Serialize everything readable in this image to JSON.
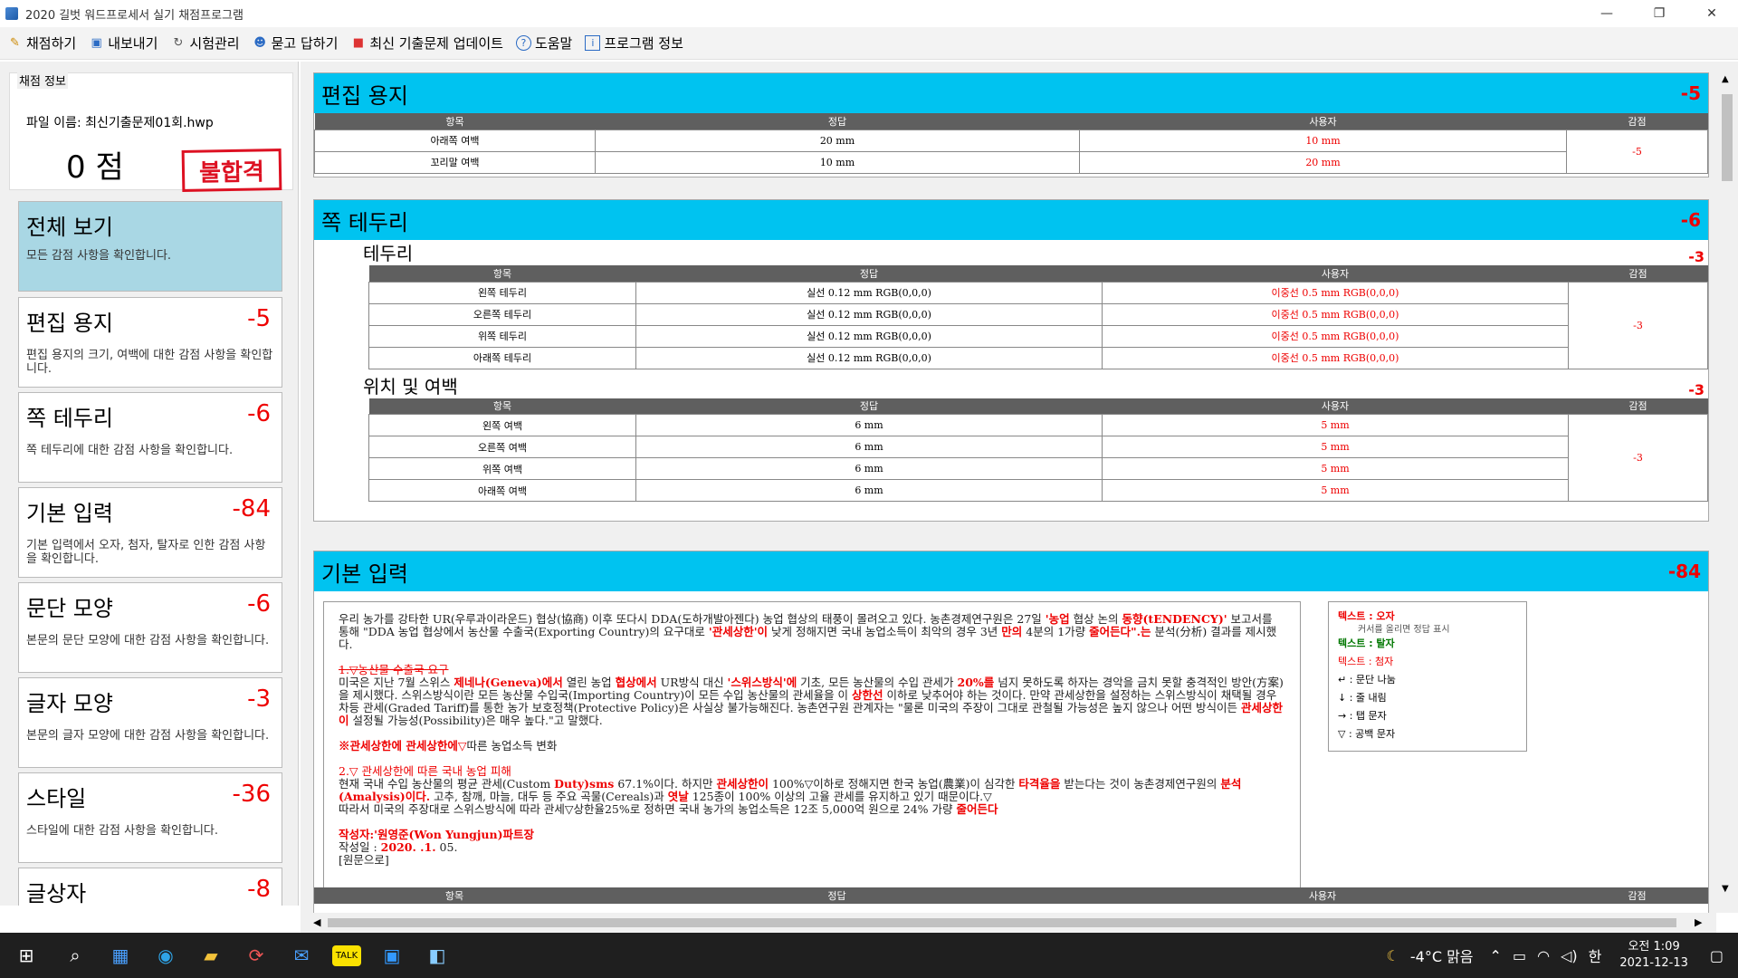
{
  "window": {
    "title": "2020 길벗 워드프로세서 실기 채점프로그램"
  },
  "menu": [
    {
      "label": "채점하기",
      "icon": "pencil-icon"
    },
    {
      "label": "내보내기",
      "icon": "save-icon"
    },
    {
      "label": "시험관리",
      "icon": "refresh-icon"
    },
    {
      "label": "묻고 답하기",
      "icon": "people-icon"
    },
    {
      "label": "최신 기출문제 업데이트",
      "icon": "gift-icon"
    },
    {
      "label": "도움말",
      "icon": "help-icon"
    },
    {
      "label": "프로그램 정보",
      "icon": "info-icon"
    }
  ],
  "info": {
    "label": "채점 정보",
    "file": "파일 이름: 최신기출문제01회.hwp",
    "score": "0 점",
    "result": "불합격"
  },
  "cards": [
    {
      "name": "전체 보기",
      "points": "",
      "desc": "모든 감점 사항을 확인합니다."
    },
    {
      "name": "편집 용지",
      "points": "-5",
      "desc": "편집 용지의 크기, 여백에 대한 감점 사항을 확인합니다."
    },
    {
      "name": "쪽 테두리",
      "points": "-6",
      "desc": "쪽 테두리에 대한 감점 사항을 확인합니다."
    },
    {
      "name": "기본 입력",
      "points": "-84",
      "desc": "기본 입력에서 오자, 첨자, 탈자로 인한 감점 사항을 확인합니다."
    },
    {
      "name": "문단 모양",
      "points": "-6",
      "desc": "본문의 문단 모양에 대한 감점 사항을 확인합니다."
    },
    {
      "name": "글자 모양",
      "points": "-3",
      "desc": "본문의 글자 모양에 대한 감점 사항을 확인합니다."
    },
    {
      "name": "스타일",
      "points": "-36",
      "desc": "스타일에 대한 감점 사항을 확인합니다."
    },
    {
      "name": "글상자",
      "points": "-8",
      "desc": ""
    }
  ],
  "headers": {
    "item": "항목",
    "answer": "정답",
    "user": "사용자",
    "deduct": "감점"
  },
  "sec1": {
    "title": "편집 용지",
    "points": "-5",
    "deduct": "-5",
    "rows": [
      [
        "아래쪽 여백",
        "20 mm",
        "10 mm"
      ],
      [
        "꼬리말 여백",
        "10 mm",
        "20 mm"
      ]
    ]
  },
  "sec2": {
    "title": "쪽 테두리",
    "points": "-6",
    "sub1": {
      "title": "테두리",
      "points": "-3",
      "deduct": "-3",
      "rows": [
        [
          "왼쪽 테두리",
          "실선 0.12 mm RGB(0,0,0)",
          "이중선 0.5 mm RGB(0,0,0)"
        ],
        [
          "오른쪽 테두리",
          "실선 0.12 mm RGB(0,0,0)",
          "이중선 0.5 mm RGB(0,0,0)"
        ],
        [
          "위쪽 테두리",
          "실선 0.12 mm RGB(0,0,0)",
          "이중선 0.5 mm RGB(0,0,0)"
        ],
        [
          "아래쪽 테두리",
          "실선 0.12 mm RGB(0,0,0)",
          "이중선 0.5 mm RGB(0,0,0)"
        ]
      ]
    },
    "sub2": {
      "title": "위치 및 여백",
      "points": "-3",
      "deduct": "-3",
      "rows": [
        [
          "왼쪽 여백",
          "6 mm",
          "5 mm"
        ],
        [
          "오른쪽 여백",
          "6 mm",
          "5 mm"
        ],
        [
          "위쪽 여백",
          "6 mm",
          "5 mm"
        ],
        [
          "아래쪽 여백",
          "6 mm",
          "5 mm"
        ]
      ]
    }
  },
  "sec3": {
    "title": "기본 입력",
    "points": "-84",
    "lines": [
      "우리 농가를 강타한 UR(우루과이라운드) 협상(協商) 이후 또다시 DDA(도하개발아젠다) 농업 협상의 태풍이 몰려오고 있다. 농촌경제연구원은 27일 ",
      "'농업",
      " 협상 논의 ",
      "동향(tENDENCY)'",
      " 보고서를 통해 \"DDA 농업 협상에서 농산물 수출국(Exporting Country)의 요구대로 ",
      "'관세상한'이",
      " 낮게 정해지면 국내 농업소득이 최악의 경우 3년 ",
      "만의",
      " 4분의 1가량 ",
      "줄어든다\".는",
      " 분석(分析) 결과를 제시했다.",
      "1.▽농산물 수출국 요구",
      "미국은 지난 7월 스위스 ",
      "제네나(Geneva)에서",
      " 열린 농업 ",
      "협상에서",
      " UR방식 대신 ",
      "'스위스방식'에",
      " 기초, 모든 농산물의 수입 관세가 ",
      "20%를",
      " 넘지 못하도록 하자는 경악을 금치 못할 충격적인 방안(方案)을 제시했다. 스위스방식이란 모든 농산물 수입국(Importing Country)이 모든 수입 농산물의 관세율을 이 ",
      "상한선",
      " 이하로 낮추어야 하는 것이다. 만약 관세상한을 설정하는 스위스방식이 채택될 경우 차등 관세(Graded Tariff)를 통한 농가 보호정책(Protective Policy)은 사실상 불가능해진다. 농촌연구원 관계자는 \"물론 미국의 주장이 그대로 관철될 가능성은 높지 않으나 어떤 방식이든 ",
      "관세상한이",
      " 설정될 가능성(Possibility)은 매우 높다.\"고 말했다.",
      "※관세상한에 관세상한에▽",
      "따른 농업소득 변화",
      "2.▽ 관세상한에 따른 국내 농업 피해",
      "현재 국내 수입 농산물의 평균 관세(Custom ",
      "Duty)sms",
      " 67.1%이다. 하지만 ",
      "관세상한이",
      " 100%▽이하로 정해지면 한국 농업(農業)이 심각한 ",
      "타격율을",
      " 받는다는 것이 농촌경제연구원의 ",
      "분석(Amalysis)이다.",
      " 고추, 참깨, 마늘, 대두 등 주요 곡물(Cereals)과 ",
      "엿날",
      " 125종이 100% 이상의 고율 관세를 유지하고 있기 때문이다.▽",
      "따라서 미국의 주장대로 스위스방식에 따라 관세▽상한율25%로 정하면 국내 농가의 농업소득은 12조 5,000억 원으로 24% 가량 ",
      "줄어든다",
      "작성자:'원영준(Won Yungjun)파트장",
      "작성일 : ",
      "2020. .1.",
      " 05.",
      "[원문으로]"
    ]
  },
  "legend": [
    "텍스트 : 오자",
    "커서를 올리면 정답 표시",
    "텍스트 : 탈자",
    "텍스트 : 첨자",
    "↵ : 문단 나눔",
    "↓ : 줄 내림",
    "→ : 탭 문자",
    "▽ : 공백 문자"
  ],
  "taskbar": {
    "weather": "-4°C 맑음",
    "ime": "한",
    "time": "오전 1:09",
    "date": "2021-12-13"
  }
}
